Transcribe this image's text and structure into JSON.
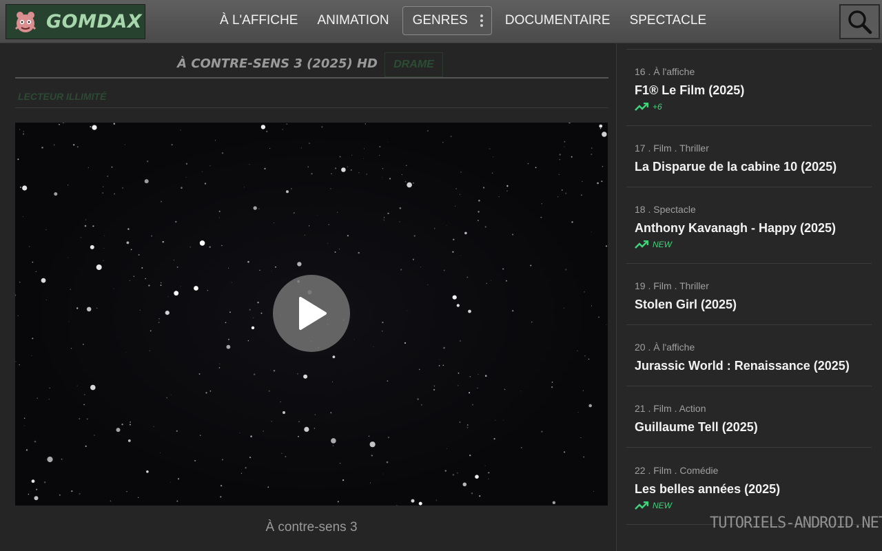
{
  "header": {
    "logo_text": "GOMDAX",
    "nav": [
      "À L'AFFICHE",
      "ANIMATION",
      "GENRES",
      "DOCUMENTAIRE",
      "SPECTACLE"
    ]
  },
  "movie": {
    "title": "À CONTRE-SENS 3 (2025) HD",
    "genre": "DRAME",
    "player_label": "LECTEUR ILLIMITÉ",
    "caption": "À contre-sens 3"
  },
  "sidebar": {
    "items": [
      {
        "meta": "16 . À l'affiche",
        "title": "F1® Le Film (2025)",
        "badge": "+6"
      },
      {
        "meta": "17 . Film . Thriller",
        "title": "La Disparue de la cabine 10 (2025)",
        "badge": ""
      },
      {
        "meta": "18 . Spectacle",
        "title": "Anthony Kavanagh - Happy (2025)",
        "badge": "NEW"
      },
      {
        "meta": "19 . Film . Thriller",
        "title": "Stolen Girl (2025)",
        "badge": ""
      },
      {
        "meta": "20 . À l'affiche",
        "title": "Jurassic World : Renaissance (2025)",
        "badge": ""
      },
      {
        "meta": "21 . Film . Action",
        "title": "Guillaume Tell (2025)",
        "badge": ""
      },
      {
        "meta": "22 . Film . Comédie",
        "title": "Les belles années (2025)",
        "badge": "NEW"
      }
    ]
  },
  "watermark": "TUTORIELS-ANDROID.NET",
  "colors": {
    "accent_green": "#3fd27a",
    "logo_bg": "#27432f",
    "header_bg": "#555555"
  }
}
